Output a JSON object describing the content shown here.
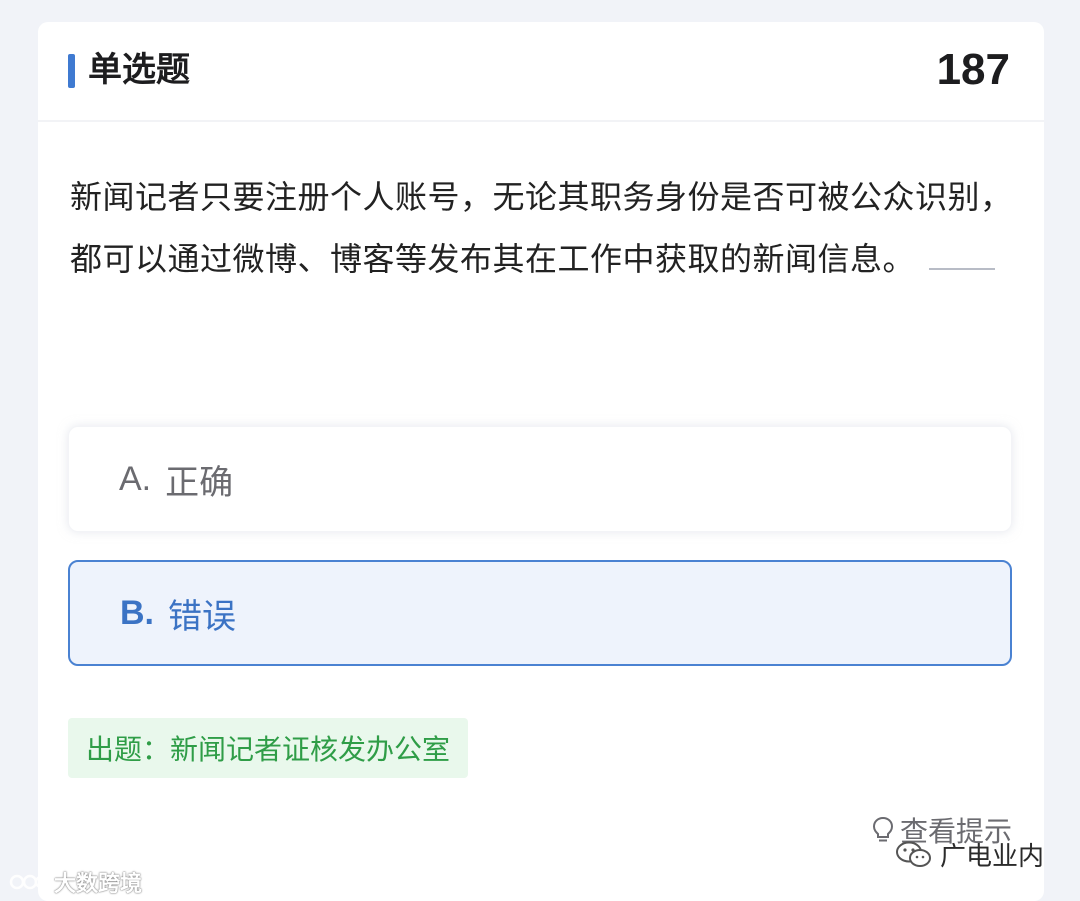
{
  "header": {
    "question_type": "单选题",
    "question_number": "187"
  },
  "question": {
    "text": "新闻记者只要注册个人账号，无论其职务身份是否可被公众识别，都可以通过微博、博客等发布其在工作中获取的新闻信息。"
  },
  "options": [
    {
      "letter": "A.",
      "label": "正确",
      "selected": false
    },
    {
      "letter": "B.",
      "label": "错误",
      "selected": true
    }
  ],
  "source": {
    "text": "出题：新闻记者证核发办公室"
  },
  "hint": {
    "label": "查看提示",
    "icon": "lightbulb-icon"
  },
  "watermarks": {
    "left": "大数跨境",
    "right": "广电业内"
  },
  "colors": {
    "accent": "#3f7ad1",
    "selected_bg": "#eef3fc",
    "source_green": "#2f9d47",
    "source_bg": "#e9f8ec"
  }
}
